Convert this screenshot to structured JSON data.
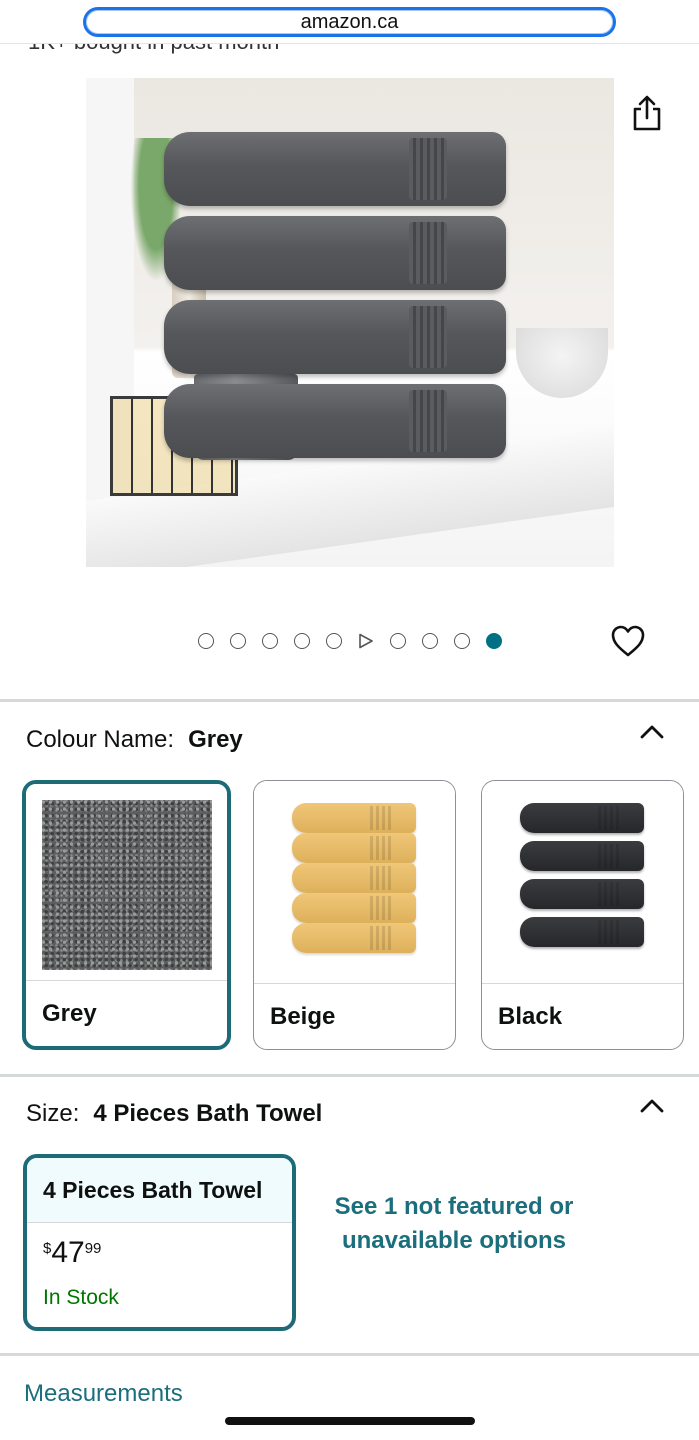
{
  "browser": {
    "url": "amazon.ca"
  },
  "product": {
    "bought_text": "1K+ bought in past month"
  },
  "gallery": {
    "image_count": 10,
    "active_index": 9,
    "video_index": 5
  },
  "colour": {
    "label": "Colour Name:",
    "selected": "Grey",
    "options": [
      {
        "name": "Grey"
      },
      {
        "name": "Beige"
      },
      {
        "name": "Black"
      }
    ]
  },
  "size": {
    "label": "Size:",
    "selected": "4 Pieces Bath Towel",
    "option": {
      "name": "4 Pieces Bath Towel",
      "price_symbol": "$",
      "price_whole": "47",
      "price_fraction": "99",
      "availability": "In Stock"
    },
    "see_more": "See 1 not featured or unavailable options"
  },
  "measurements": {
    "label": "Measurements"
  },
  "colors": {
    "accent": "#007185",
    "selected_border": "#1d6b77",
    "link": "#1b6e7c",
    "in_stock": "#007600"
  }
}
